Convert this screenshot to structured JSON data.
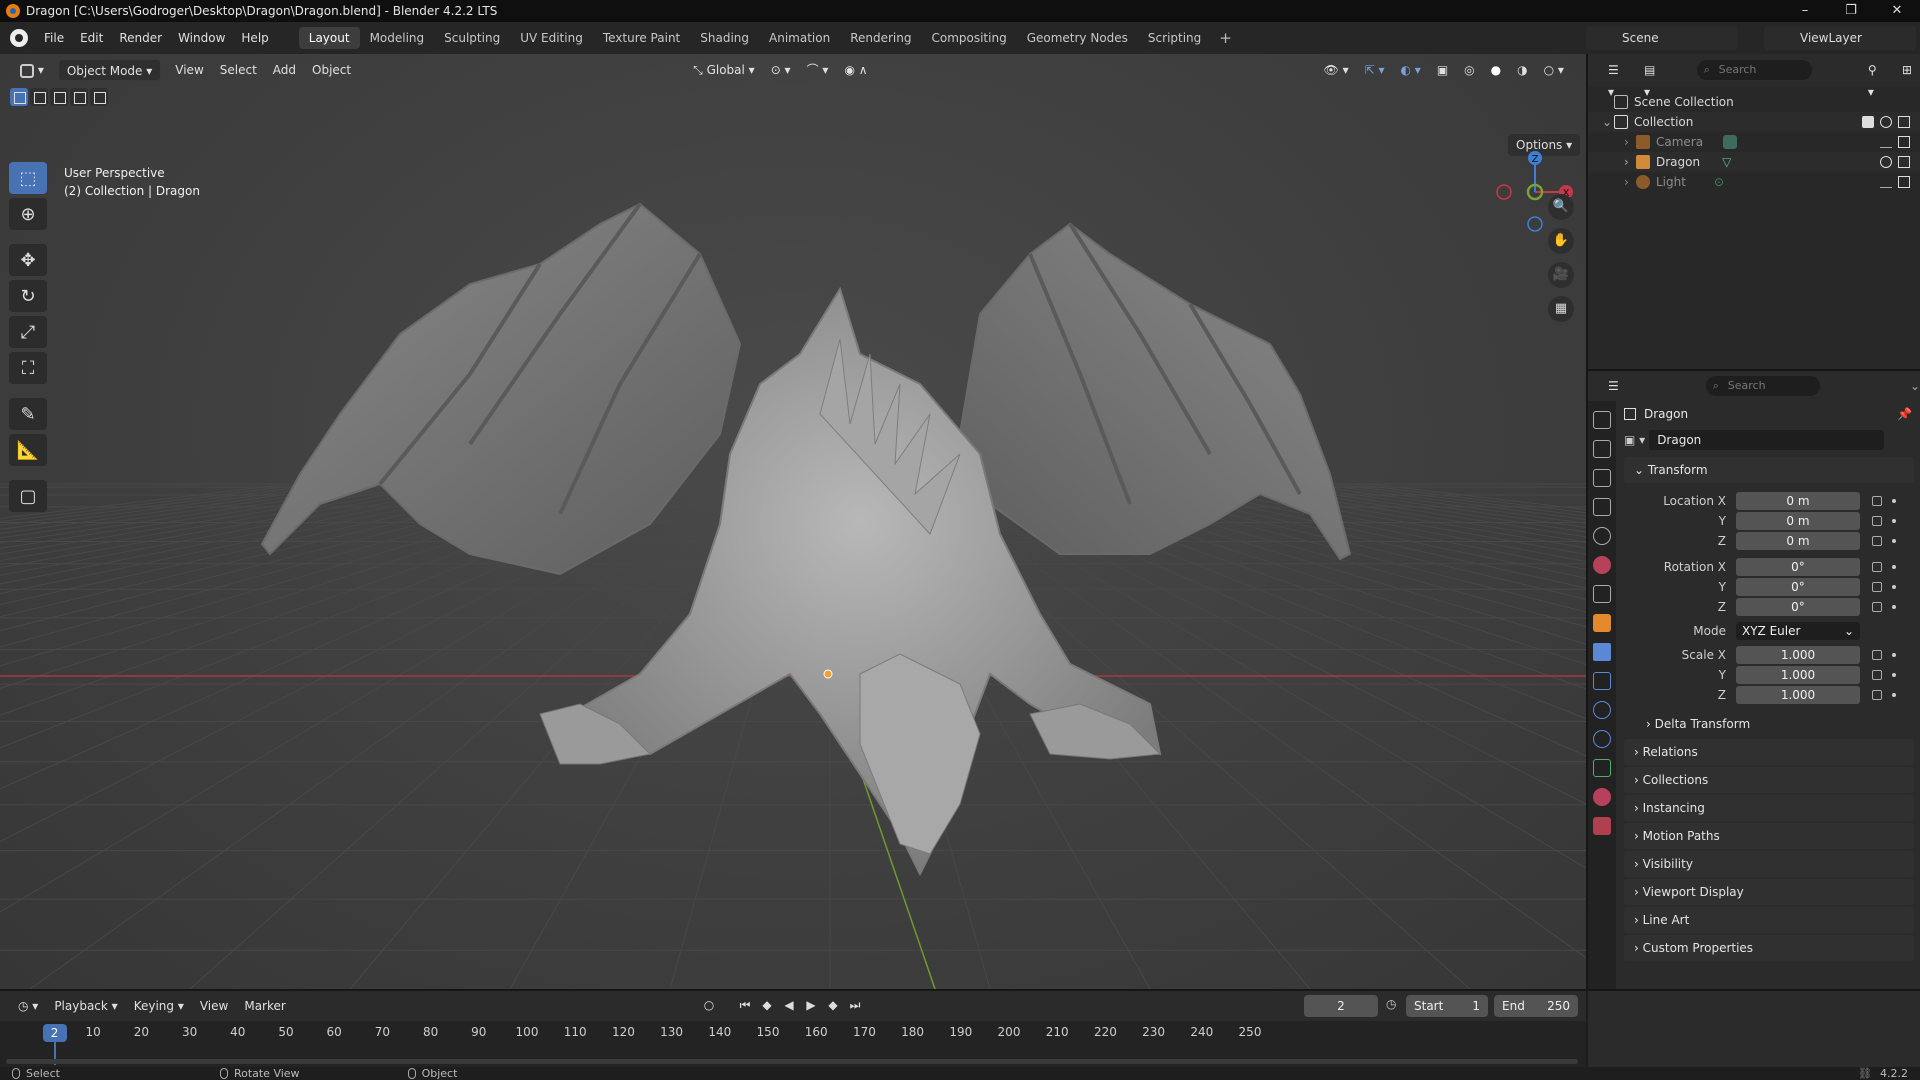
{
  "window": {
    "title": "Dragon [C:\\Users\\Godroger\\Desktop\\Dragon\\Dragon.blend] - Blender 4.2.2 LTS",
    "controls": [
      "–",
      "❐",
      "✕"
    ]
  },
  "menubar": {
    "menus": [
      "File",
      "Edit",
      "Render",
      "Window",
      "Help"
    ],
    "workspaces": [
      "Layout",
      "Modeling",
      "Sculpting",
      "UV Editing",
      "Texture Paint",
      "Shading",
      "Animation",
      "Rendering",
      "Compositing",
      "Geometry Nodes",
      "Scripting"
    ],
    "active_workspace": "Layout",
    "add_workspace": "+",
    "scene": "Scene",
    "view_layer": "ViewLayer"
  },
  "viewport": {
    "mode": "Object Mode",
    "menus": [
      "View",
      "Select",
      "Add",
      "Object"
    ],
    "transform_orientation": "Global",
    "options_label": "Options",
    "info_line1": "User Perspective",
    "info_line2": "(2) Collection | Dragon",
    "gizmo_axes": [
      "Z",
      "X"
    ],
    "colors": {
      "x_axis": "#c8384b",
      "y_axis": "#7aa335",
      "z_axis": "#3d7fd6",
      "active_tool": "#4772b3",
      "dragon": "#9c9c9c"
    }
  },
  "outliner": {
    "search_placeholder": "Search",
    "rows": [
      {
        "label": "Scene Collection"
      },
      {
        "label": "Collection"
      },
      {
        "label": "Camera"
      },
      {
        "label": "Dragon"
      },
      {
        "label": "Light"
      }
    ]
  },
  "properties": {
    "search_placeholder": "Search",
    "context_name": "Dragon",
    "object_name": "Dragon",
    "transform_title": "Transform",
    "location_label": "Location X",
    "rotation_label": "Rotation X",
    "scale_label": "Scale X",
    "y_label": "Y",
    "z_label": "Z",
    "location": [
      "0 m",
      "0 m",
      "0 m"
    ],
    "rotation": [
      "0°",
      "0°",
      "0°"
    ],
    "mode_label": "Mode",
    "mode_value": "XYZ Euler",
    "scale": [
      "1.000",
      "1.000",
      "1.000"
    ],
    "delta_transform": "Delta Transform",
    "collapsed_panels": [
      "Relations",
      "Collections",
      "Instancing",
      "Motion Paths",
      "Visibility",
      "Viewport Display",
      "Line Art",
      "Custom Properties"
    ]
  },
  "timeline": {
    "menus": [
      "Playback",
      "Keying",
      "View",
      "Marker"
    ],
    "current_frame": "2",
    "start_label": "Start",
    "start_value": "1",
    "end_label": "End",
    "end_value": "250",
    "ruler_ticks": [
      "10",
      "20",
      "30",
      "40",
      "50",
      "60",
      "70",
      "80",
      "90",
      "100",
      "110",
      "120",
      "130",
      "140",
      "150",
      "160",
      "170",
      "180",
      "190",
      "200",
      "210",
      "220",
      "230",
      "240",
      "250"
    ]
  },
  "statusbar": {
    "left_hint": "Select",
    "middle_hint": "Rotate View",
    "right_hint": "Object",
    "version": "4.2.2"
  }
}
